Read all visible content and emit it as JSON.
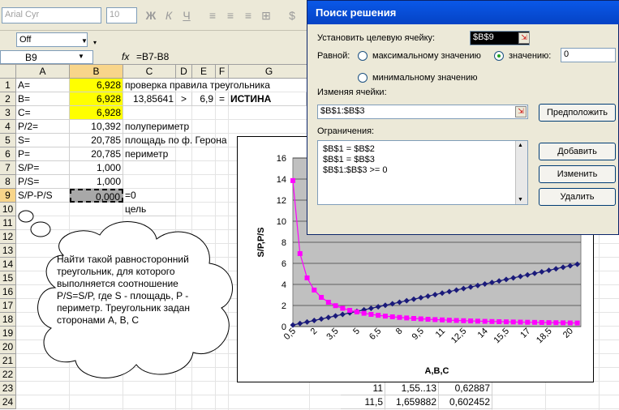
{
  "toolbar": {
    "font_name": "Arial Cyr",
    "font_size": "10",
    "font_color_box": "Off"
  },
  "formula_bar": {
    "name_box": "B9",
    "fx": "fx",
    "formula": "=B7-B8"
  },
  "columns": [
    "A",
    "B",
    "C",
    "D",
    "E",
    "F",
    "G"
  ],
  "rows": [
    "1",
    "2",
    "3",
    "4",
    "5",
    "6",
    "7",
    "8",
    "9",
    "10",
    "11",
    "12",
    "13",
    "14",
    "15",
    "16",
    "17",
    "18",
    "19",
    "20",
    "21",
    "22",
    "23",
    "24"
  ],
  "cells": {
    "A1": "A=",
    "B1": "6,928",
    "C1": "проверка правила треугольника",
    "A2": "B=",
    "B2": "6,928",
    "C2": "13,85641",
    "D2": ">",
    "E2": "6,9",
    "F2": "=",
    "G2": "ИСТИНА",
    "A3": "C=",
    "B3": "6,928",
    "A4": "P/2=",
    "B4": "10,392",
    "C4": "полупериметр",
    "A5": "S=",
    "B5": "20,785",
    "C5": "площадь по ф. Герона",
    "A6": "P=",
    "B6": "20,785",
    "C6": "периметр",
    "A7": "S/P=",
    "B7": "1,000",
    "A8": "P/S=",
    "B8": "1,000",
    "A9": "S/P-P/S",
    "B9": "0,000",
    "C9": "=0",
    "C10": "цель",
    "row23_a": "11",
    "row23_b": "1,55..13",
    "row23_c": "0,62887",
    "row24_a": "11,5",
    "row24_b": "1,659882",
    "row24_c": "0,602452"
  },
  "callout_text": "Найти такой равносторонний треугольник, для которого выполняется соотношение P/S=S/P, где S - площадь, P - периметр. Треугольник задан сторонами А, В, С",
  "dialog": {
    "title": "Поиск решения",
    "target_label": "Установить целевую ячейку:",
    "target_value": "$B$9",
    "equal_label": "Равной:",
    "max_label": "максимальному значению",
    "value_label": "значению:",
    "value_input": "0",
    "min_label": "минимальному значению",
    "changing_label": "Изменяя ячейки:",
    "changing_value": "$B$1:$B$3",
    "guess_button": "Предположить",
    "constraints_label": "Ограничения:",
    "constraints": [
      "$B$1 = $B$2",
      "$B$1 = $B$3",
      "$B$1:$B$3 >= 0"
    ],
    "add_button": "Добавить",
    "change_button": "Изменить",
    "delete_button": "Удалить"
  },
  "chart_data": {
    "type": "line",
    "xlabel": "A,B,C",
    "ylabel": "S/P,P/S",
    "ylim": [
      0,
      16
    ],
    "yticks": [
      0,
      2,
      4,
      6,
      8,
      10,
      12,
      14,
      16
    ],
    "xtick_labels": [
      "0,5",
      "2",
      "3,5",
      "5",
      "6,5",
      "8",
      "9,5",
      "11",
      "12,5",
      "14",
      "15,5",
      "17",
      "18,5",
      "20"
    ],
    "x": [
      0.5,
      1,
      1.5,
      2,
      2.5,
      3,
      3.5,
      4,
      4.5,
      5,
      5.5,
      6,
      6.5,
      7,
      7.5,
      8,
      8.5,
      9,
      9.5,
      10,
      10.5,
      11,
      11.5,
      12,
      12.5,
      13,
      13.5,
      14,
      14.5,
      15,
      15.5,
      16,
      16.5,
      17,
      17.5,
      18,
      18.5,
      19,
      19.5,
      20,
      20.5
    ],
    "series": [
      {
        "color": "#1a1a7a",
        "marker": "diamond",
        "values": [
          0.144,
          0.289,
          0.433,
          0.577,
          0.722,
          0.866,
          1.01,
          1.155,
          1.299,
          1.443,
          1.588,
          1.732,
          1.876,
          2.021,
          2.165,
          2.309,
          2.454,
          2.598,
          2.742,
          2.887,
          3.031,
          3.175,
          3.32,
          3.464,
          3.608,
          3.753,
          3.897,
          4.041,
          4.186,
          4.33,
          4.474,
          4.619,
          4.763,
          4.907,
          5.052,
          5.196,
          5.34,
          5.485,
          5.629,
          5.774,
          5.918
        ]
      },
      {
        "color": "#ff00ff",
        "marker": "square",
        "values": [
          13.856,
          6.928,
          4.619,
          3.464,
          2.771,
          2.309,
          1.98,
          1.732,
          1.54,
          1.386,
          1.26,
          1.155,
          1.066,
          0.99,
          0.924,
          0.866,
          0.815,
          0.77,
          0.729,
          0.693,
          0.66,
          0.63,
          0.602,
          0.577,
          0.554,
          0.533,
          0.513,
          0.495,
          0.478,
          0.462,
          0.447,
          0.433,
          0.42,
          0.408,
          0.396,
          0.385,
          0.375,
          0.365,
          0.355,
          0.346,
          0.338
        ]
      }
    ],
    "grid": true,
    "plot_background": "#c0c0c0"
  }
}
